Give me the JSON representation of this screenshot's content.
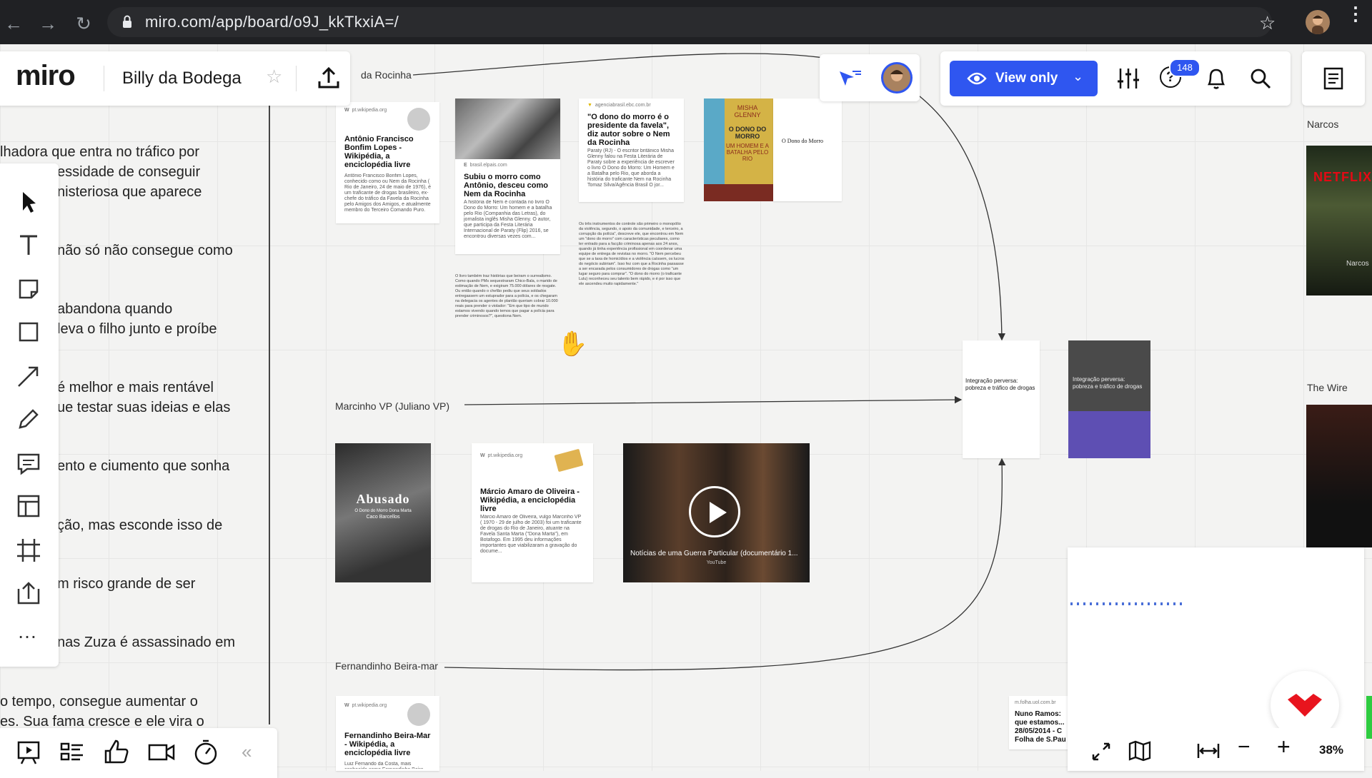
{
  "browser": {
    "url": "miro.com/app/board/o9J_kkTkxiA=/"
  },
  "board": {
    "logo": "miro",
    "title": "Billy da Bodega",
    "view_mode_label": "View only",
    "notification_count": "148",
    "zoom_level": "38%"
  },
  "left_text_lines": [
    "lhadora que entra no tráfico por",
    "essidade de conseguir",
    "nisteriosa que aparece",
    "não só não consegue como",
    "abandona quando",
    "leva o filho junto e proíbe",
    "é melhor e mais rentável",
    "ue testar suas ideias e elas",
    "ento e ciumento que sonha",
    "ção, mas esconde isso de",
    "m risco grande de ser",
    "nas Zuza é assassinado em",
    "o tempo, consegue aumentar o",
    "es. Sua fama cresce e ele vira o"
  ],
  "frame_labels": {
    "rocinha": "da Rocinha",
    "marcinho": "Marcinho VP (Juliano VP)",
    "fernandinho": "Fernandinho Beira-mar",
    "narcos": "Narcos",
    "the_wire": "The Wire"
  },
  "cards": {
    "antonio": {
      "source": "pt.wikipedia.org",
      "title": "Antônio Francisco Bonfim Lopes - Wikipédia, a enciclopédia livre",
      "body": "Antônio Francisco Bonfim Lopes, conhecido como ou Nem da Rocinha ( Rio de Janeiro, 24 de maio de 1976), é um traficante de drogas brasileiro, ex-chefe do tráfico da Favela da Rocinha pelo Amigos dos Amigos, e atualmente membro do Terceiro Comando Puro."
    },
    "elpais": {
      "source": "brasil.elpais.com",
      "title": "Subiu o morro como Antônio, desceu como Nem da Rocinha",
      "body": "A história de Nem é contada no livro O Dono do Morro: Um homem e a batalha pelo Rio (Companhia das Letras), do jornalista inglês Misha Glenny. O autor, que participa da Festa Literária Internacional de Paraty (Flip) 2016, se encontrou diversas vezes com..."
    },
    "agencia": {
      "source": "agenciabrasil.ebc.com.br",
      "title": "\"O dono do morro é o presidente da favela\", diz autor sobre o Nem da Rocinha",
      "body": "Paraty (RJ) - O escritor britânico Misha Glenny falou na Festa Literária de Paraty sobre a experiência de escrever o livro O Dono do Morro: Um Homem e a Batalha pelo Rio, que aborda a história do traficante Nem na Rocinha Tomaz Silva/Agência Brasil O jor..."
    },
    "book_glenny": {
      "author": "MISHA GLENNY",
      "title": "O DONO DO MORRO",
      "subtitle": "UM HOMEM E A BATALHA PELO RIO",
      "inner_title": "O Dono do Morro"
    },
    "note_left": "O livro também traz histórias que beiram o surrealismo. Como quando PMs sequestraram Chico-Bala, o marido de estimação de Nem, e exigiram 75.000 dólares de resgate. Ou então quando o chefão pediu que seus soldados entregassem um estuprador para a polícia, e os chegaram na delegacia os agentes de plantão queriam cobrar 10.000 reais para prender o violador: \"Em que tipo de mundo estamos vivendo quando temos que pagar a polícia para prender criminosos?\", questiona Nem.",
    "note_right": "Os três instrumentos de controle são primeiro o monopólio da violência, segundo, o apoio da comunidade, e terceiro, a corrupção da polícia\", descreve ele, que encontrou em Nem um \"dono do morro\" com características peculiares, como ter entrado para a facção criminosa apenas aos 24 anos, quando já tinha experiência profissional em coordenar uma equipe de entrega de revistas no morro. \"O Nem percebeu que se a taxa de homicídios e a violência caíssem, os lucros do negócio subiriam\". Isso fez com que a Rocinha passasse a ser encarada pelos consumidores de drogas como \"um lugar seguro para comprar\". \"O dono do morro (o traficante Lulu) reconheceu seu talento bem rápido, e é por isso que ele ascendeu muito rapidamente.\"",
    "integracao": {
      "title": "Integração perversa: pobreza e tráfico de drogas"
    },
    "abusado": {
      "title": "Abusado",
      "subtitle": "O Dono do Morro Dona Marta",
      "author": "Caco Barcellos"
    },
    "marcio": {
      "source": "pt.wikipedia.org",
      "title": "Márcio Amaro de Oliveira - Wikipédia, a enciclopédia livre",
      "body": "Márcio Amaro de Oliveira, vulgo Marcinho VP ( 1970 - 29 de julho de 2003) foi um traficante de drogas do Rio de Janeiro, atuante na Favela Santa Marta (\"Dona Marta\"), em Botafogo. Em 1995 deu informações importantes que viabilizaram a gravação do docume..."
    },
    "video": {
      "title": "Notícias de uma Guerra Particular (documentário 1...",
      "source": "YouTube"
    },
    "fernandinho": {
      "source": "pt.wikipedia.org",
      "title": "Fernandinho Beira-Mar - Wikipédia, a enciclopédia livre",
      "body": "Luiz Fernando da Costa, mais conhecido como Fernandinho Beira-"
    },
    "folha": {
      "source": "m.folha.uol.com.br",
      "title": "Nuno Ramos: que estamos... 28/05/2014 - C Folha de S.Pau"
    },
    "narcos_thumb": "NETFLIX",
    "narcos_caption": "Narcos"
  },
  "icons": {
    "left_toolbar": [
      "select-arrow-icon",
      "text-icon",
      "sticky-note-icon",
      "rectangle-icon",
      "connection-arrow-icon",
      "pen-icon",
      "comment-icon",
      "template-icon",
      "frame-icon",
      "upload-icon",
      "more-icon"
    ],
    "bottom_toolbar": [
      "presentation-icon",
      "board-list-icon",
      "voting-icon",
      "video-chat-icon",
      "timer-icon",
      "collapse-icon"
    ]
  },
  "colors": {
    "accent_blue": "#2f56f0",
    "badge_blue": "#2f56f0",
    "miro_red": "#e8141e"
  }
}
